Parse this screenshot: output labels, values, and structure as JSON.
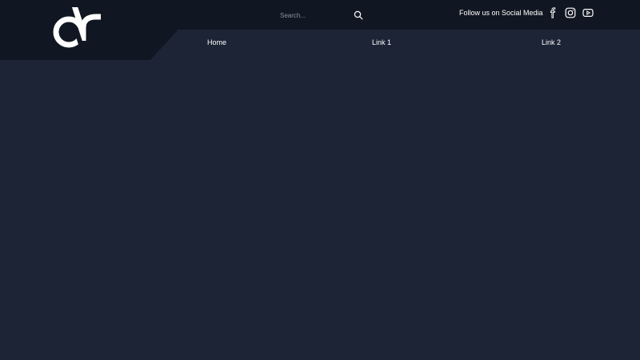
{
  "header": {
    "search": {
      "placeholder": "Search...",
      "icon": "search-icon"
    },
    "social": {
      "label": "Follow us on Social Media",
      "icons": [
        "facebook-icon",
        "instagram-icon",
        "youtube-icon"
      ]
    },
    "logo": "logo-icon"
  },
  "nav": {
    "items": [
      {
        "label": "Home"
      },
      {
        "label": "Link 1"
      },
      {
        "label": "Link 2"
      }
    ]
  },
  "colors": {
    "background": "#1d2436",
    "header": "#111722",
    "text": "#ffffff"
  }
}
